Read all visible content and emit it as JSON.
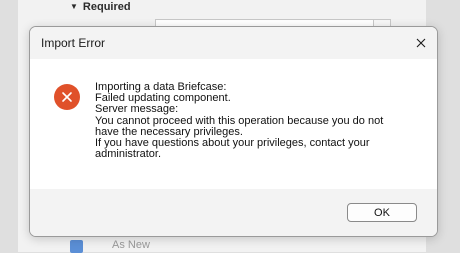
{
  "background": {
    "section_header": "Required",
    "checkbox_label": "As New"
  },
  "dialog": {
    "title": "Import Error",
    "message_lines": [
      "Importing a data Briefcase:",
      "Failed updating component.",
      "Server message:",
      "You cannot proceed with this operation because you do not",
      "have the necessary privileges.",
      "If you have questions about your privileges, contact your",
      "administrator."
    ],
    "ok_label": "OK",
    "icons": {
      "error": "error-x-icon",
      "close": "close-icon"
    },
    "colors": {
      "error_icon": "#e0512a",
      "checkbox": "#5b8fd6"
    }
  }
}
